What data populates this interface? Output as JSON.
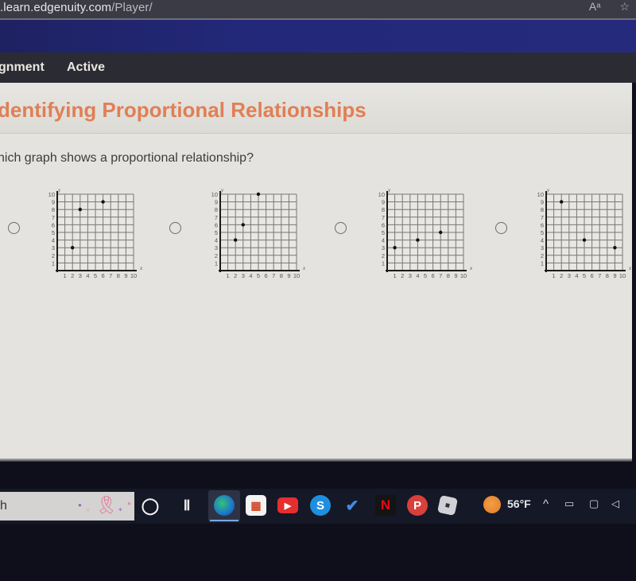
{
  "browser": {
    "url_host": ".learn.edgenuity.com",
    "url_path": "/Player/",
    "icons": [
      "read-aloud-icon",
      "favorites-add-icon"
    ],
    "read_aloud_glyph": "Aᵃ",
    "favorites_glyph": "☆"
  },
  "nav": {
    "items": [
      {
        "label": "gnment"
      },
      {
        "label": "Active"
      }
    ]
  },
  "lesson": {
    "title": "dentifying Proportional Relationships",
    "question": "hich graph shows a proportional relationship?",
    "options": [
      {
        "id": "A",
        "selected": false,
        "points": [
          [
            2,
            3
          ],
          [
            3,
            8
          ],
          [
            6,
            9
          ]
        ]
      },
      {
        "id": "B",
        "selected": false,
        "points": [
          [
            2,
            4
          ],
          [
            3,
            6
          ],
          [
            5,
            10
          ]
        ]
      },
      {
        "id": "C",
        "selected": false,
        "points": [
          [
            1,
            3
          ],
          [
            4,
            4
          ],
          [
            7,
            5
          ]
        ]
      },
      {
        "id": "D",
        "selected": false,
        "points": [
          [
            2,
            9
          ],
          [
            5,
            4
          ],
          [
            9,
            3
          ]
        ]
      }
    ],
    "graph_axes": {
      "x_label": "x",
      "y_label": "y",
      "x_ticks": [
        "1",
        "2",
        "3",
        "4",
        "5",
        "6",
        "7",
        "8",
        "9",
        "10"
      ],
      "y_ticks": [
        "1",
        "2",
        "3",
        "4",
        "5",
        "6",
        "7",
        "8",
        "9",
        "10"
      ],
      "range": [
        0,
        10
      ]
    },
    "colors": {
      "title": "#e07f55",
      "grid": "#777777",
      "axis": "#1a1a1a",
      "point": "#111111"
    }
  },
  "taskbar": {
    "search_text": "h",
    "apps": [
      {
        "name": "cortana",
        "glyph": "◯"
      },
      {
        "name": "task-view",
        "glyph": "Ⅱ"
      },
      {
        "name": "edge",
        "glyph": "e",
        "active": true
      },
      {
        "name": "store",
        "glyph": "▦"
      },
      {
        "name": "youtube",
        "glyph": "▶"
      },
      {
        "name": "skype",
        "glyph": "S"
      },
      {
        "name": "todo",
        "glyph": "✔"
      },
      {
        "name": "netflix",
        "glyph": "N"
      },
      {
        "name": "pinterest",
        "glyph": "P"
      },
      {
        "name": "roblox",
        "glyph": "■"
      }
    ],
    "weather": "56°F",
    "tray": {
      "chevron": "^",
      "battery": "▭",
      "meet": "▢",
      "volume": "◁"
    }
  }
}
